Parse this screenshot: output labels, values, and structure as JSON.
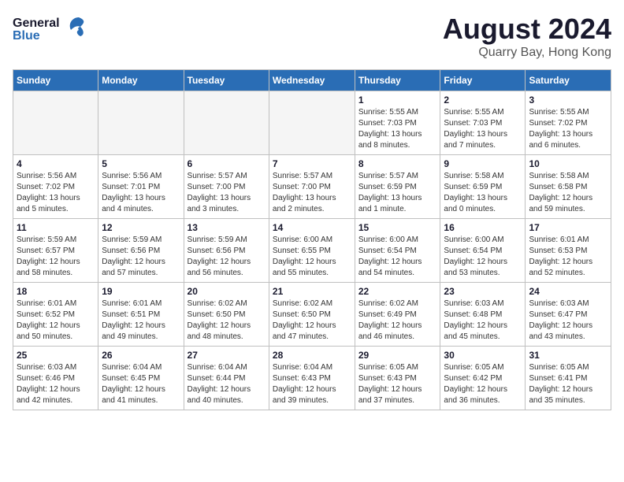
{
  "logo": {
    "line1": "General",
    "line2": "Blue"
  },
  "title": "August 2024",
  "location": "Quarry Bay, Hong Kong",
  "days_of_week": [
    "Sunday",
    "Monday",
    "Tuesday",
    "Wednesday",
    "Thursday",
    "Friday",
    "Saturday"
  ],
  "weeks": [
    [
      {
        "day": "",
        "info": ""
      },
      {
        "day": "",
        "info": ""
      },
      {
        "day": "",
        "info": ""
      },
      {
        "day": "",
        "info": ""
      },
      {
        "day": "1",
        "info": "Sunrise: 5:55 AM\nSunset: 7:03 PM\nDaylight: 13 hours\nand 8 minutes."
      },
      {
        "day": "2",
        "info": "Sunrise: 5:55 AM\nSunset: 7:03 PM\nDaylight: 13 hours\nand 7 minutes."
      },
      {
        "day": "3",
        "info": "Sunrise: 5:55 AM\nSunset: 7:02 PM\nDaylight: 13 hours\nand 6 minutes."
      }
    ],
    [
      {
        "day": "4",
        "info": "Sunrise: 5:56 AM\nSunset: 7:02 PM\nDaylight: 13 hours\nand 5 minutes."
      },
      {
        "day": "5",
        "info": "Sunrise: 5:56 AM\nSunset: 7:01 PM\nDaylight: 13 hours\nand 4 minutes."
      },
      {
        "day": "6",
        "info": "Sunrise: 5:57 AM\nSunset: 7:00 PM\nDaylight: 13 hours\nand 3 minutes."
      },
      {
        "day": "7",
        "info": "Sunrise: 5:57 AM\nSunset: 7:00 PM\nDaylight: 13 hours\nand 2 minutes."
      },
      {
        "day": "8",
        "info": "Sunrise: 5:57 AM\nSunset: 6:59 PM\nDaylight: 13 hours\nand 1 minute."
      },
      {
        "day": "9",
        "info": "Sunrise: 5:58 AM\nSunset: 6:59 PM\nDaylight: 13 hours\nand 0 minutes."
      },
      {
        "day": "10",
        "info": "Sunrise: 5:58 AM\nSunset: 6:58 PM\nDaylight: 12 hours\nand 59 minutes."
      }
    ],
    [
      {
        "day": "11",
        "info": "Sunrise: 5:59 AM\nSunset: 6:57 PM\nDaylight: 12 hours\nand 58 minutes."
      },
      {
        "day": "12",
        "info": "Sunrise: 5:59 AM\nSunset: 6:56 PM\nDaylight: 12 hours\nand 57 minutes."
      },
      {
        "day": "13",
        "info": "Sunrise: 5:59 AM\nSunset: 6:56 PM\nDaylight: 12 hours\nand 56 minutes."
      },
      {
        "day": "14",
        "info": "Sunrise: 6:00 AM\nSunset: 6:55 PM\nDaylight: 12 hours\nand 55 minutes."
      },
      {
        "day": "15",
        "info": "Sunrise: 6:00 AM\nSunset: 6:54 PM\nDaylight: 12 hours\nand 54 minutes."
      },
      {
        "day": "16",
        "info": "Sunrise: 6:00 AM\nSunset: 6:54 PM\nDaylight: 12 hours\nand 53 minutes."
      },
      {
        "day": "17",
        "info": "Sunrise: 6:01 AM\nSunset: 6:53 PM\nDaylight: 12 hours\nand 52 minutes."
      }
    ],
    [
      {
        "day": "18",
        "info": "Sunrise: 6:01 AM\nSunset: 6:52 PM\nDaylight: 12 hours\nand 50 minutes."
      },
      {
        "day": "19",
        "info": "Sunrise: 6:01 AM\nSunset: 6:51 PM\nDaylight: 12 hours\nand 49 minutes."
      },
      {
        "day": "20",
        "info": "Sunrise: 6:02 AM\nSunset: 6:50 PM\nDaylight: 12 hours\nand 48 minutes."
      },
      {
        "day": "21",
        "info": "Sunrise: 6:02 AM\nSunset: 6:50 PM\nDaylight: 12 hours\nand 47 minutes."
      },
      {
        "day": "22",
        "info": "Sunrise: 6:02 AM\nSunset: 6:49 PM\nDaylight: 12 hours\nand 46 minutes."
      },
      {
        "day": "23",
        "info": "Sunrise: 6:03 AM\nSunset: 6:48 PM\nDaylight: 12 hours\nand 45 minutes."
      },
      {
        "day": "24",
        "info": "Sunrise: 6:03 AM\nSunset: 6:47 PM\nDaylight: 12 hours\nand 43 minutes."
      }
    ],
    [
      {
        "day": "25",
        "info": "Sunrise: 6:03 AM\nSunset: 6:46 PM\nDaylight: 12 hours\nand 42 minutes."
      },
      {
        "day": "26",
        "info": "Sunrise: 6:04 AM\nSunset: 6:45 PM\nDaylight: 12 hours\nand 41 minutes."
      },
      {
        "day": "27",
        "info": "Sunrise: 6:04 AM\nSunset: 6:44 PM\nDaylight: 12 hours\nand 40 minutes."
      },
      {
        "day": "28",
        "info": "Sunrise: 6:04 AM\nSunset: 6:43 PM\nDaylight: 12 hours\nand 39 minutes."
      },
      {
        "day": "29",
        "info": "Sunrise: 6:05 AM\nSunset: 6:43 PM\nDaylight: 12 hours\nand 37 minutes."
      },
      {
        "day": "30",
        "info": "Sunrise: 6:05 AM\nSunset: 6:42 PM\nDaylight: 12 hours\nand 36 minutes."
      },
      {
        "day": "31",
        "info": "Sunrise: 6:05 AM\nSunset: 6:41 PM\nDaylight: 12 hours\nand 35 minutes."
      }
    ]
  ]
}
